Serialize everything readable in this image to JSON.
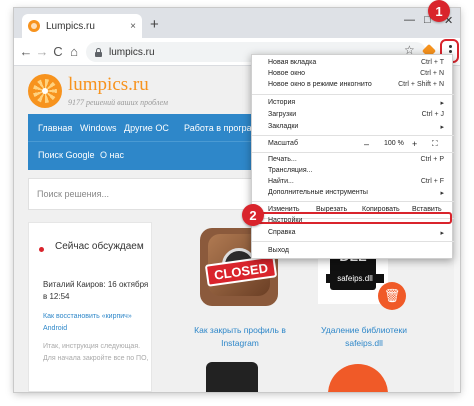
{
  "browser": {
    "tab_title": "Lumpics.ru",
    "tab_close": "×",
    "new_tab": "+",
    "minimize": "—",
    "maximize": "□",
    "close": "✕",
    "url": "lumpics.ru",
    "back": "←",
    "forward": "→",
    "reload": "C",
    "home": "⌂",
    "bookmark_star": "☆"
  },
  "site": {
    "name": "lumpics.ru",
    "tagline": "9177 решений ваших проблем",
    "nav": [
      "Главная",
      "Windows",
      "Другие ОС",
      "Работа в программах",
      "Поиск Google",
      "О нас"
    ],
    "search_placeholder": "Поиск решения..."
  },
  "widget": {
    "title": "Сейчас обсуждаем",
    "author": "Виталий Каиров: 16 октября в 12:54",
    "link": "Как восстановить «кирпич» Android",
    "excerpt": "Итак, инструкция следующая. Для начала закройте все по ПО,"
  },
  "articles": [
    {
      "closed_label": "CLOSED",
      "title": "Как закрыть профиль в Instagram"
    },
    {
      "file_label": "DLL",
      "file_name": "safeips.dll",
      "trash_icon": "🗑",
      "title": "Удаление библиотеки safeips.dll"
    }
  ],
  "menu": {
    "items": [
      {
        "label": "Новая вкладка",
        "shortcut": "Ctrl + T"
      },
      {
        "label": "Новое окно",
        "shortcut": "Ctrl + N"
      },
      {
        "label": "Новое окно в режиме инкогнито",
        "shortcut": "Ctrl + Shift + N"
      },
      {
        "label": "История",
        "shortcut": "▸"
      },
      {
        "label": "Загрузки",
        "shortcut": "Ctrl + J"
      },
      {
        "label": "Закладки",
        "shortcut": "▸"
      },
      {
        "label": "Печать...",
        "shortcut": "Ctrl + P"
      },
      {
        "label": "Трансляция...",
        "shortcut": ""
      },
      {
        "label": "Найти...",
        "shortcut": "Ctrl + F"
      },
      {
        "label": "Дополнительные инструменты",
        "shortcut": "▸"
      },
      {
        "label": "Настройки",
        "shortcut": ""
      },
      {
        "label": "Справка",
        "shortcut": "▸"
      },
      {
        "label": "Выход",
        "shortcut": ""
      }
    ],
    "zoom": {
      "label": "Масштаб",
      "minus": "–",
      "value": "100 %",
      "plus": "+",
      "fullscreen": "⛶"
    },
    "edit": {
      "label": "Изменить",
      "cut": "Вырезать",
      "copy": "Копировать",
      "paste": "Вставить"
    }
  },
  "badges": [
    "1",
    "2"
  ],
  "colors": {
    "accent_red": "#d9242c",
    "nav_blue": "#2e87c9",
    "brand_orange": "#f7931e"
  }
}
